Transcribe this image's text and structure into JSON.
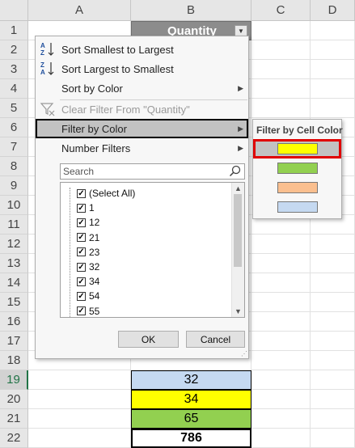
{
  "columns": [
    "A",
    "B",
    "C",
    "D"
  ],
  "rows": [
    "1",
    "2",
    "3",
    "4",
    "5",
    "6",
    "7",
    "8",
    "9",
    "10",
    "11",
    "12",
    "13",
    "14",
    "15",
    "16",
    "17",
    "18",
    "19",
    "20",
    "21",
    "22"
  ],
  "header_cell": {
    "label": "Quantity",
    "color": "#8c8c8c"
  },
  "data_cells": [
    {
      "row": "19",
      "value": "32",
      "color": "#c5d9f1"
    },
    {
      "row": "20",
      "value": "34",
      "color": "#ffff00"
    },
    {
      "row": "21",
      "value": "65",
      "color": "#92d050"
    },
    {
      "row": "22",
      "value": "786",
      "color": "#ffffff",
      "bold": true
    }
  ],
  "menu": {
    "sort_asc": "Sort Smallest to Largest",
    "sort_desc": "Sort Largest to Smallest",
    "sort_color": "Sort by Color",
    "clear_filter": "Clear Filter From \"Quantity\"",
    "filter_color": "Filter by Color",
    "number_filters": "Number Filters",
    "search_placeholder": "Search",
    "items": [
      "(Select All)",
      "1",
      "12",
      "21",
      "23",
      "32",
      "34",
      "54",
      "55"
    ],
    "ok": "OK",
    "cancel": "Cancel"
  },
  "submenu": {
    "title": "Filter by Cell Color",
    "swatches": [
      "#ffff00",
      "#92d050",
      "#fabf8f",
      "#c5d9f1"
    ]
  }
}
